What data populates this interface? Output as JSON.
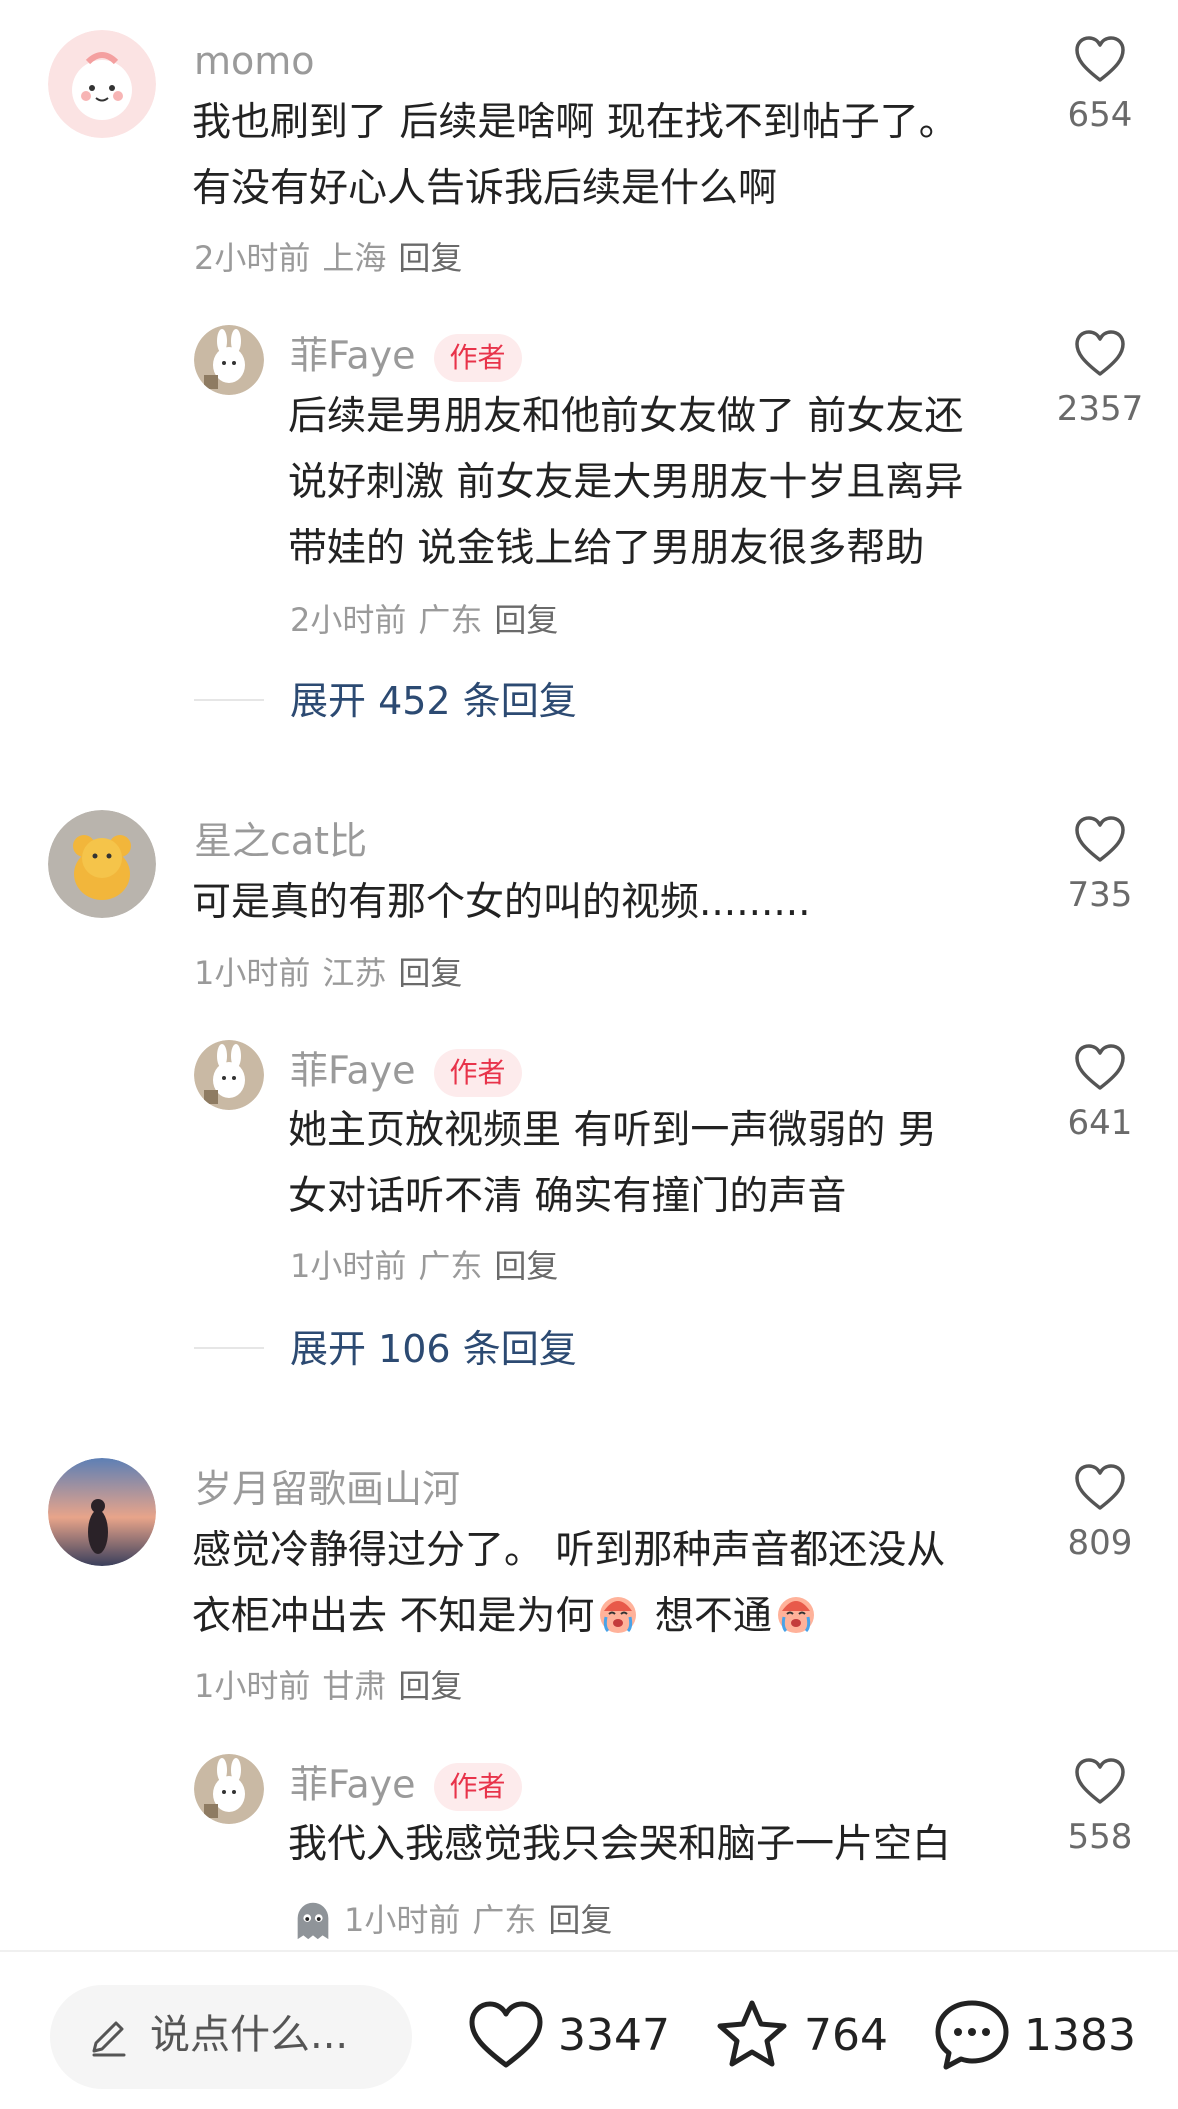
{
  "comments": [
    {
      "user": "momo",
      "lines": [
        "我也刷到了 后续是啥啊 现在找不到帖子了。",
        "有没有好心人告诉我后续是什么啊"
      ],
      "time": "2小时前",
      "location": "上海",
      "reply_label": "回复",
      "likes": "654",
      "sub_reply": {
        "user": "菲Faye",
        "badge": "作者",
        "lines": [
          "后续是男朋友和他前女友做了 前女友还",
          "说好刺激 前女友是大男朋友十岁且离异",
          "带娃的 说金钱上给了男朋友很多帮助"
        ],
        "time": "2小时前",
        "location": "广东",
        "reply_label": "回复",
        "likes": "2357"
      },
      "expand": "展开 452 条回复"
    },
    {
      "user": "星之cat比",
      "lines": [
        "可是真的有那个女的叫的视频........."
      ],
      "time": "1小时前",
      "location": "江苏",
      "reply_label": "回复",
      "likes": "735",
      "sub_reply": {
        "user": "菲Faye",
        "badge": "作者",
        "lines": [
          "她主页放视频里 有听到一声微弱的 男",
          "女对话听不清 确实有撞门的声音"
        ],
        "time": "1小时前",
        "location": "广东",
        "reply_label": "回复",
        "likes": "641"
      },
      "expand": "展开 106 条回复"
    },
    {
      "user": "岁月留歌画山河",
      "lines": [
        "感觉冷静得过分了。 听到那种声音都还没从",
        "衣柜冲出去 不知是为何",
        "想不通"
      ],
      "time": "1小时前",
      "location": "甘肃",
      "reply_label": "回复",
      "likes": "809",
      "sub_reply": {
        "user": "菲Faye",
        "badge": "作者",
        "lines": [
          "我代入我感觉我只会哭和脑子一片空白"
        ],
        "time": "1小时前",
        "location": "广东",
        "reply_label": "回复",
        "likes": "558"
      }
    }
  ],
  "bottom_bar": {
    "input_placeholder": "说点什么...",
    "likes": "3347",
    "favorites": "764",
    "comments": "1383"
  },
  "icons": [
    "heart-icon",
    "star-icon",
    "comment-icon",
    "pencil-icon",
    "crying-emoji",
    "ghost-emoji"
  ],
  "colors": {
    "author_badge_bg": "#fdebec",
    "author_badge_text": "#e8334a",
    "expand_link": "#2c4a72"
  }
}
